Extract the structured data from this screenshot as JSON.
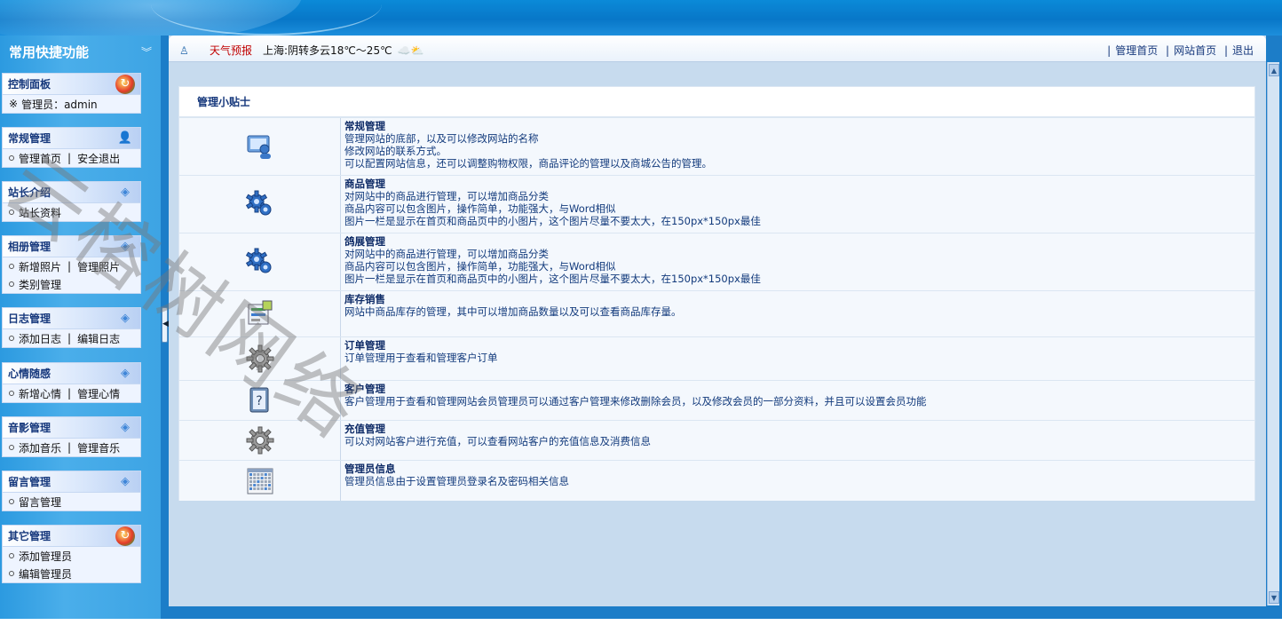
{
  "sidebar": {
    "title": "常用快捷功能",
    "chevron": "double-chevron-down-icon",
    "menus": [
      {
        "title": "控制面板",
        "icon": "globe-refresh-icon",
        "rows": [
          {
            "prefix": "※",
            "items": [
              "管理员：admin"
            ]
          }
        ]
      },
      {
        "title": "常规管理",
        "icon": "user-icon",
        "rows": [
          {
            "items": [
              "管理首页",
              "安全退出"
            ]
          }
        ]
      },
      {
        "title": "站长介绍",
        "icon": "diamond-icon",
        "rows": [
          {
            "items": [
              "站长资料"
            ]
          }
        ]
      },
      {
        "title": "相册管理",
        "icon": "diamond-icon",
        "rows": [
          {
            "items": [
              "新增照片",
              "管理照片"
            ]
          },
          {
            "items": [
              "类别管理"
            ]
          }
        ]
      },
      {
        "title": "日志管理",
        "icon": "diamond-icon",
        "rows": [
          {
            "items": [
              "添加日志",
              "编辑日志"
            ]
          }
        ]
      },
      {
        "title": "心情随感",
        "icon": "diamond-icon",
        "rows": [
          {
            "items": [
              "新增心情",
              "管理心情"
            ]
          }
        ]
      },
      {
        "title": "音影管理",
        "icon": "diamond-icon",
        "rows": [
          {
            "items": [
              "添加音乐",
              "管理音乐"
            ]
          }
        ]
      },
      {
        "title": "留言管理",
        "icon": "diamond-icon",
        "rows": [
          {
            "items": [
              "留言管理"
            ]
          }
        ]
      },
      {
        "title": "其它管理",
        "icon": "globe-refresh-icon",
        "rows": [
          {
            "items": [
              "添加管理员"
            ]
          },
          {
            "items": [
              "编辑管理员"
            ]
          }
        ]
      }
    ]
  },
  "toolbar": {
    "weather_label": "天气预报",
    "weather_text": "上海:阴转多云18℃～25℃",
    "links": [
      "管理首页",
      "网站首页",
      "退出"
    ]
  },
  "tips": {
    "title": "管理小贴士",
    "rows": [
      {
        "icon": "computer-user-icon",
        "title": "常规管理",
        "lines": [
          "管理网站的底部，以及可以修改网站的名称",
          "修改网站的联系方式。",
          "可以配置网站信息，还可以调整购物权限，商品评论的管理以及商城公告的管理。"
        ]
      },
      {
        "icon": "gears-blue-icon",
        "title": "商品管理",
        "lines": [
          "对网站中的商品进行管理，可以增加商品分类",
          "商品内容可以包含图片，操作简单，功能强大，与Word相似",
          "图片一栏是显示在首页和商品页中的小图片，这个图片尽量不要太大，在150px*150px最佳"
        ]
      },
      {
        "icon": "gears-blue-icon",
        "title": "鸽展管理",
        "lines": [
          "对网站中的商品进行管理，可以增加商品分类",
          "商品内容可以包含图片，操作简单，功能强大，与Word相似",
          "图片一栏是显示在首页和商品页中的小图片，这个图片尽量不要太大，在150px*150px最佳"
        ]
      },
      {
        "icon": "inventory-icon",
        "title": "库存销售",
        "lines": [
          "网站中商品库存的管理，其中可以增加商品数量以及可以查看商品库存量。"
        ]
      },
      {
        "icon": "gear-icon",
        "title": "订单管理",
        "lines": [
          "订单管理用于查看和管理客户订单"
        ]
      },
      {
        "icon": "help-book-icon",
        "title": "客户管理",
        "lines": [
          "客户管理用于查看和管理网站会员管理员可以通过客户管理来修改删除会员，以及修改会员的一部分资料，并且可以设置会员功能"
        ]
      },
      {
        "icon": "gear-icon",
        "title": "充值管理",
        "lines": [
          "可以对网站客户进行充值，可以查看网站客户的充值信息及消费信息"
        ]
      },
      {
        "icon": "calendar-grid-icon",
        "title": "管理员信息",
        "lines": [
          "管理员信息由于设置管理员登录名及密码相关信息"
        ]
      }
    ]
  },
  "watermark": "云榕树网络"
}
